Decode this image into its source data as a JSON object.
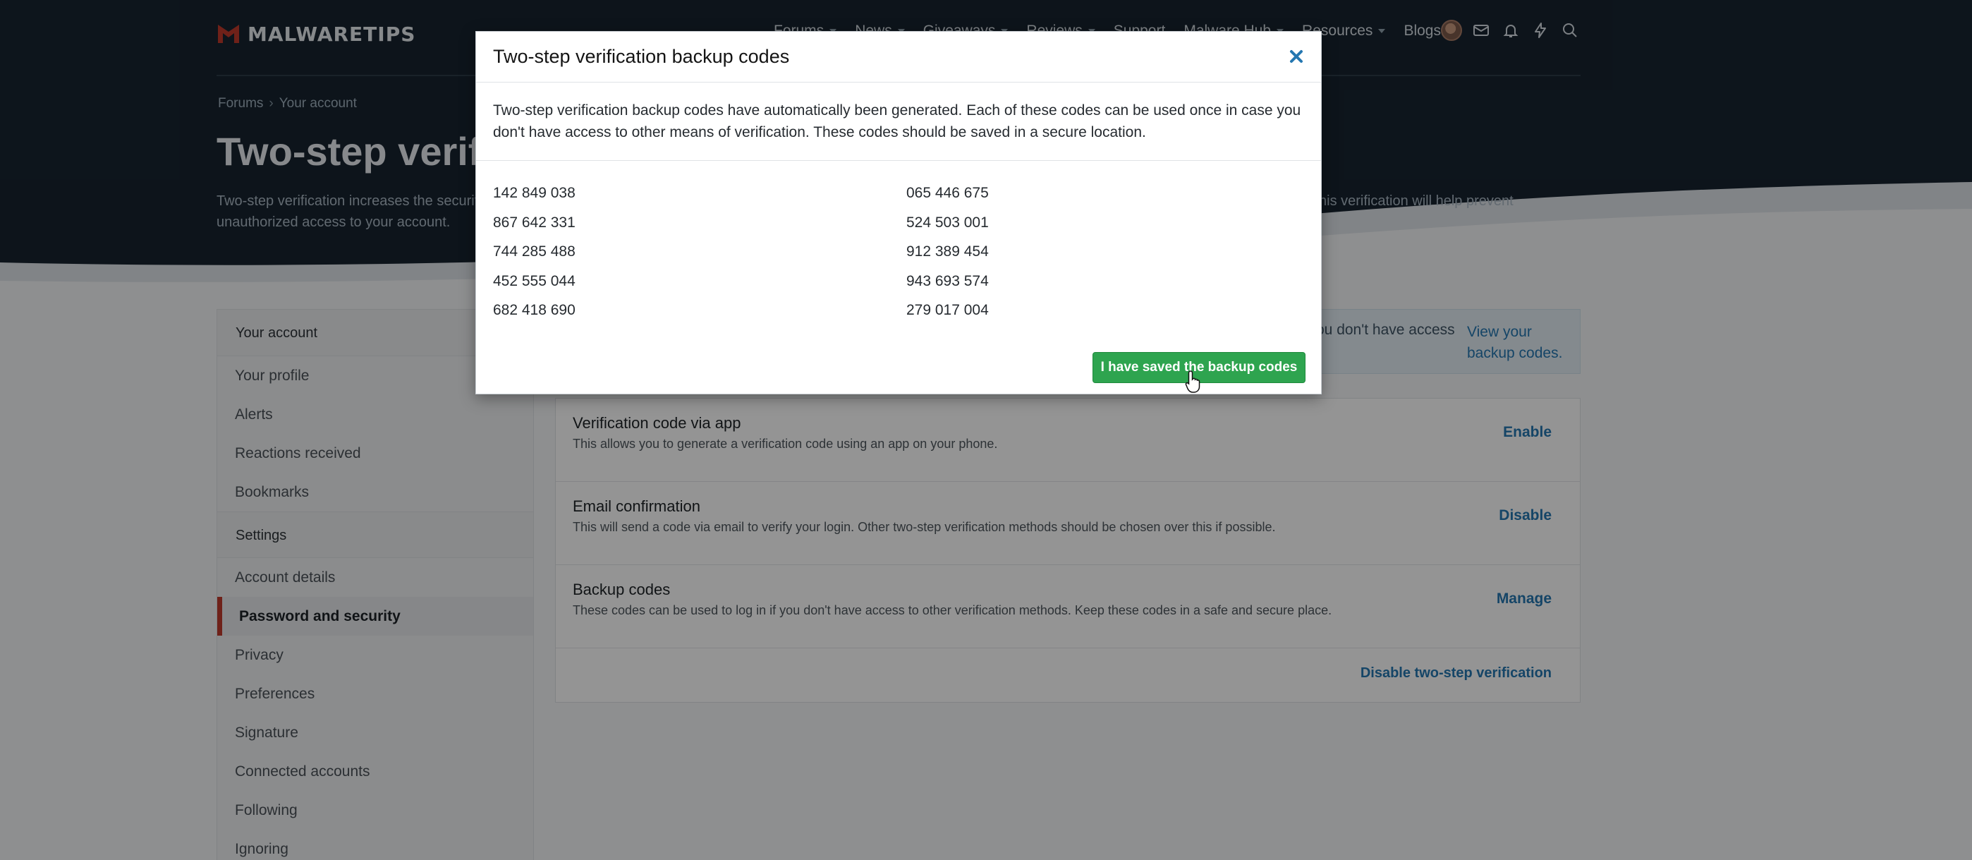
{
  "header": {
    "logo_text": "MALWARETIPS",
    "nav": [
      {
        "label": "Forums",
        "dropdown": true
      },
      {
        "label": "News",
        "dropdown": true
      },
      {
        "label": "Giveaways",
        "dropdown": true
      },
      {
        "label": "Reviews",
        "dropdown": true
      },
      {
        "label": "Support",
        "dropdown": false
      },
      {
        "label": "Malware Hub",
        "dropdown": true
      },
      {
        "label": "Resources",
        "dropdown": true
      },
      {
        "label": "Blogs",
        "dropdown": false
      }
    ],
    "icons": [
      "avatar",
      "envelope-icon",
      "bell-icon",
      "bolt-icon",
      "search-icon"
    ]
  },
  "breadcrumb": {
    "items": [
      "Forums",
      "Your account"
    ],
    "separator": "›"
  },
  "page": {
    "title": "Two-step verification",
    "description": "Two-step verification increases the security of your account by requiring you to provide an additional code to complete the login process. If your password is ever compromised, this verification will help prevent unauthorized access to your account."
  },
  "sidebar": {
    "sections": [
      {
        "label": "Your account",
        "items": [
          "Your profile",
          "Alerts",
          "Reactions received",
          "Bookmarks"
        ]
      },
      {
        "label": "Settings",
        "items": [
          "Account details",
          "Password and security",
          "Privacy",
          "Preferences",
          "Signature",
          "Connected accounts",
          "Following",
          "Ignoring"
        ]
      }
    ],
    "active_item": "Password and security"
  },
  "info": {
    "text": "ou don't have access",
    "link": "View your backup codes."
  },
  "methods": [
    {
      "title": "Verification code via app",
      "desc": "This allows you to generate a verification code using an app on your phone.",
      "action": "Enable"
    },
    {
      "title": "Email confirmation",
      "desc": "This will send a code via email to verify your login. Other two-step verification methods should be chosen over this if possible.",
      "action": "Disable"
    },
    {
      "title": "Backup codes",
      "desc": "These codes can be used to log in if you don't have access to other verification methods. Keep these codes in a safe and secure place.",
      "action": "Manage"
    }
  ],
  "disable_link": "Disable two-step verification",
  "modal": {
    "title": "Two-step verification backup codes",
    "body": "Two-step verification backup codes have automatically been generated. Each of these codes can be used once in case you don't have access to other means of verification. These codes should be saved in a secure location.",
    "codes": [
      "142 849 038",
      "065 446 675",
      "867 642 331",
      "524 503 001",
      "744 285 488",
      "912 389 454",
      "452 555 044",
      "943 693 574",
      "682 418 690",
      "279 017 004"
    ],
    "button": "I have saved the backup codes",
    "button_color": "#2ea44f"
  },
  "colors": {
    "header_bg": "#172430",
    "link": "#2577b1",
    "active_marker": "#c0392b",
    "logo_mark": "#c0392b"
  }
}
